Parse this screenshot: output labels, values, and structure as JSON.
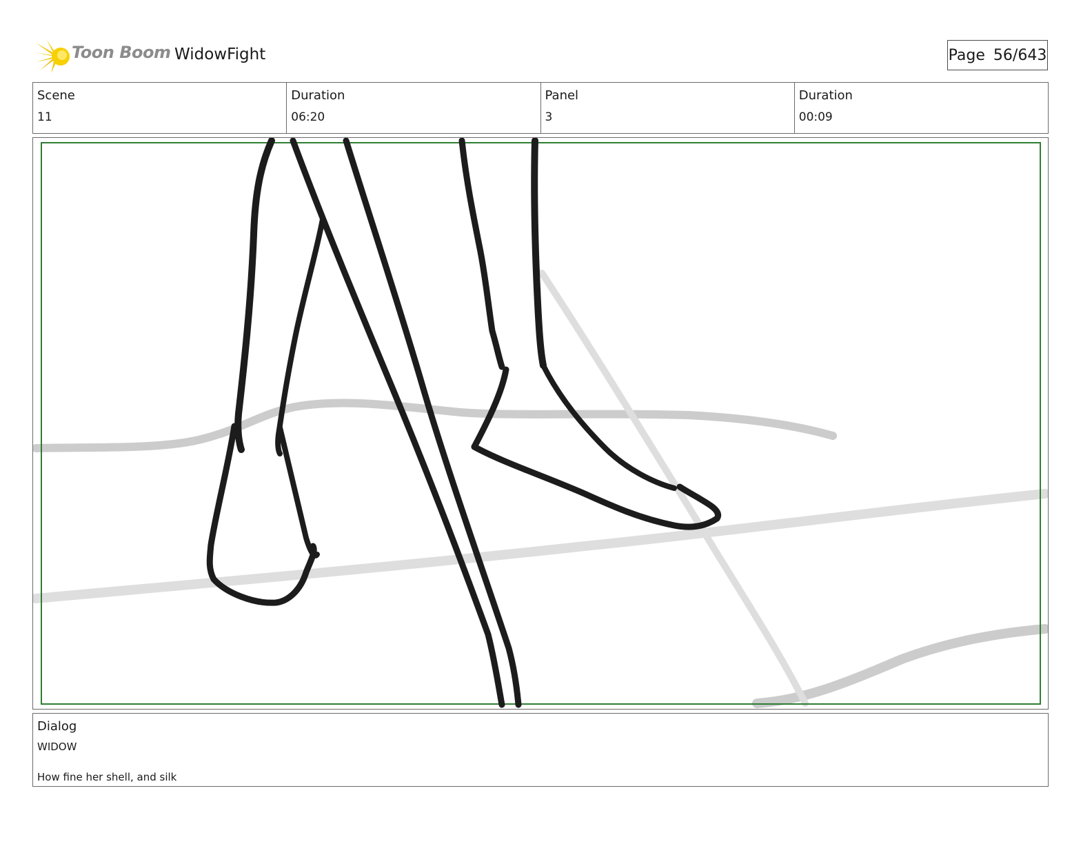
{
  "header": {
    "brand": "Toon Boom",
    "project_title": "WidowFight",
    "page_label": "Page",
    "page_number": "56/643"
  },
  "info": {
    "scene_label": "Scene",
    "scene_value": "11",
    "scene_duration_label": "Duration",
    "scene_duration_value": "06:20",
    "panel_label": "Panel",
    "panel_value": "3",
    "panel_duration_label": "Duration",
    "panel_duration_value": "00:09"
  },
  "dialog": {
    "label": "Dialog",
    "speaker": "WIDOW",
    "line": "How fine her shell, and silk"
  },
  "colors": {
    "safe_frame": "#2e7d32",
    "ink": "#1c1c1c",
    "guide_lines": "#c8c8c8",
    "logo_sun": "#f2c200"
  }
}
